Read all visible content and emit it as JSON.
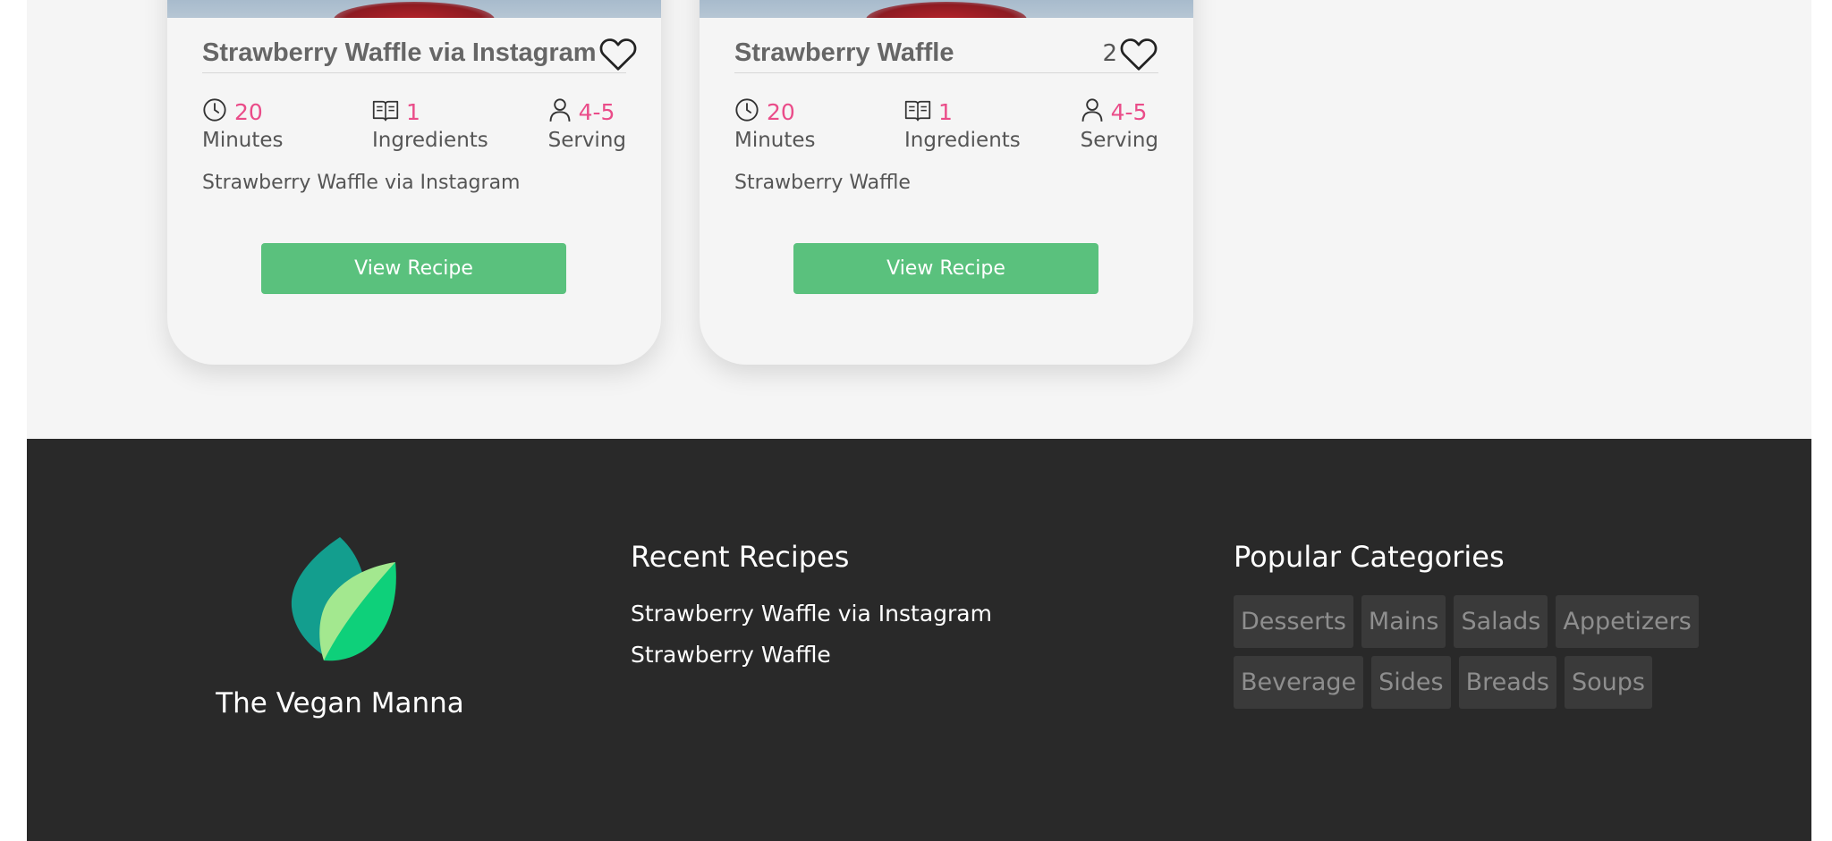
{
  "cards": [
    {
      "title": "Strawberry Waffle via Instagram",
      "likes": "",
      "time_value": "20",
      "time_label": "Minutes",
      "ingredients_value": "1",
      "ingredients_label": "Ingredients",
      "serving_value": "4-5",
      "serving_label": "Serving",
      "description": "Strawberry Waffle via Instagram",
      "button_label": "View Recipe"
    },
    {
      "title": "Strawberry Waffle",
      "likes": "2",
      "time_value": "20",
      "time_label": "Minutes",
      "ingredients_value": "1",
      "ingredients_label": "Ingredients",
      "serving_value": "4-5",
      "serving_label": "Serving",
      "description": "Strawberry Waffle",
      "button_label": "View Recipe"
    }
  ],
  "footer": {
    "brand_name": "The Vegan Manna",
    "recent_heading": "Recent Recipes",
    "recent_recipes": [
      "Strawberry Waffle via Instagram",
      "Strawberry Waffle"
    ],
    "popular_heading": "Popular Categories",
    "categories": [
      "Desserts",
      "Mains",
      "Salads",
      "Appetizers",
      "Beverage",
      "Sides",
      "Breads",
      "Soups"
    ]
  },
  "icons": {
    "time": "clock-icon",
    "ingredients": "book-icon",
    "serving": "person-icon",
    "like": "heart-icon",
    "logo": "leaf-logo-icon"
  },
  "colors": {
    "accent_value": "#ea4c89",
    "button": "#5ac17d",
    "footer_bg": "#292929",
    "page_bg": "#f5f5f5",
    "tag_bg": "#3a3a3a"
  }
}
